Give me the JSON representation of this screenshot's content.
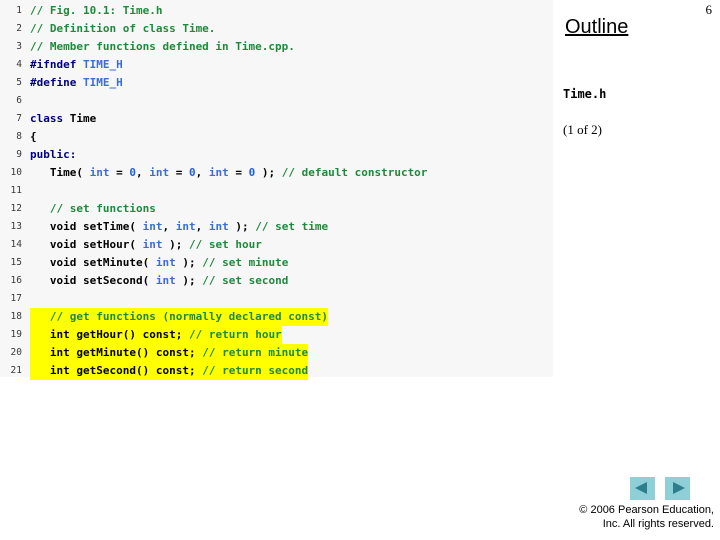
{
  "page_number": "6",
  "outline": {
    "title": "Outline",
    "file_label": "Time.h",
    "part_label": "(1 of 2)"
  },
  "footer": {
    "prev_label": "previous-slide",
    "next_label": "next-slide",
    "copyright_line1": "© 2006 Pearson Education,",
    "copyright_line2": "Inc.  All rights reserved."
  },
  "colors": {
    "panel_bg": "#f7f7f7",
    "keyword": "#000080",
    "type": "#3c6ed4",
    "number": "#1f5fd8",
    "comment": "#1f8a3c",
    "highlight": "#ffff00",
    "nav_button_bg": "#8ecfd8",
    "nav_arrow": "#2e7f8c"
  },
  "code": {
    "language": "cpp",
    "lines": [
      {
        "n": "1",
        "highlight": false,
        "tokens": [
          {
            "t": "// Fig. 10.1: Time.h",
            "c": "cmt"
          }
        ]
      },
      {
        "n": "2",
        "highlight": false,
        "tokens": [
          {
            "t": "// Definition of class Time.",
            "c": "cmt"
          }
        ]
      },
      {
        "n": "3",
        "highlight": false,
        "tokens": [
          {
            "t": "// Member functions defined in Time.cpp.",
            "c": "cmt"
          }
        ]
      },
      {
        "n": "4",
        "highlight": false,
        "tokens": [
          {
            "t": "#ifndef",
            "c": "pp"
          },
          {
            "t": " ",
            "c": "pl"
          },
          {
            "t": "TIME_H",
            "c": "ppid"
          }
        ]
      },
      {
        "n": "5",
        "highlight": false,
        "tokens": [
          {
            "t": "#define",
            "c": "pp"
          },
          {
            "t": " ",
            "c": "pl"
          },
          {
            "t": "TIME_H",
            "c": "ppid"
          }
        ]
      },
      {
        "n": "6",
        "highlight": false,
        "tokens": []
      },
      {
        "n": "7",
        "highlight": false,
        "tokens": [
          {
            "t": "class",
            "c": "kw"
          },
          {
            "t": " Time",
            "c": "pl"
          }
        ]
      },
      {
        "n": "8",
        "highlight": false,
        "tokens": [
          {
            "t": "{",
            "c": "pl"
          }
        ]
      },
      {
        "n": "9",
        "highlight": false,
        "tokens": [
          {
            "t": "public:",
            "c": "kw"
          }
        ]
      },
      {
        "n": "10",
        "highlight": false,
        "tokens": [
          {
            "t": "   Time( ",
            "c": "pl"
          },
          {
            "t": "int",
            "c": "type"
          },
          {
            "t": " = ",
            "c": "pl"
          },
          {
            "t": "0",
            "c": "num"
          },
          {
            "t": ", ",
            "c": "pl"
          },
          {
            "t": "int",
            "c": "type"
          },
          {
            "t": " = ",
            "c": "pl"
          },
          {
            "t": "0",
            "c": "num"
          },
          {
            "t": ", ",
            "c": "pl"
          },
          {
            "t": "int",
            "c": "type"
          },
          {
            "t": " = ",
            "c": "pl"
          },
          {
            "t": "0",
            "c": "num"
          },
          {
            "t": " ); ",
            "c": "pl"
          },
          {
            "t": "// default constructor",
            "c": "cmt"
          }
        ]
      },
      {
        "n": "11",
        "highlight": false,
        "tokens": []
      },
      {
        "n": "12",
        "highlight": false,
        "tokens": [
          {
            "t": "   ",
            "c": "pl"
          },
          {
            "t": "// set functions",
            "c": "cmt"
          }
        ]
      },
      {
        "n": "13",
        "highlight": false,
        "tokens": [
          {
            "t": "   void setTime( ",
            "c": "pl"
          },
          {
            "t": "int",
            "c": "type"
          },
          {
            "t": ", ",
            "c": "pl"
          },
          {
            "t": "int",
            "c": "type"
          },
          {
            "t": ", ",
            "c": "pl"
          },
          {
            "t": "int",
            "c": "type"
          },
          {
            "t": " ); ",
            "c": "pl"
          },
          {
            "t": "// set time",
            "c": "cmt"
          }
        ]
      },
      {
        "n": "14",
        "highlight": false,
        "tokens": [
          {
            "t": "   void setHour( ",
            "c": "pl"
          },
          {
            "t": "int",
            "c": "type"
          },
          {
            "t": " ); ",
            "c": "pl"
          },
          {
            "t": "// set hour",
            "c": "cmt"
          }
        ]
      },
      {
        "n": "15",
        "highlight": false,
        "tokens": [
          {
            "t": "   void setMinute( ",
            "c": "pl"
          },
          {
            "t": "int",
            "c": "type"
          },
          {
            "t": " ); ",
            "c": "pl"
          },
          {
            "t": "// set minute",
            "c": "cmt"
          }
        ]
      },
      {
        "n": "16",
        "highlight": false,
        "tokens": [
          {
            "t": "   void setSecond( ",
            "c": "pl"
          },
          {
            "t": "int",
            "c": "type"
          },
          {
            "t": " ); ",
            "c": "pl"
          },
          {
            "t": "// set second",
            "c": "cmt"
          }
        ]
      },
      {
        "n": "17",
        "highlight": false,
        "tokens": []
      },
      {
        "n": "18",
        "highlight": true,
        "tokens": [
          {
            "t": "   ",
            "c": "pl"
          },
          {
            "t": "// get functions (normally declared const)",
            "c": "cmt"
          }
        ]
      },
      {
        "n": "19",
        "highlight": true,
        "tokens": [
          {
            "t": "   ",
            "c": "pl"
          },
          {
            "t": "int",
            "c": "type"
          },
          {
            "t": " getHour() const; ",
            "c": "pl"
          },
          {
            "t": "// return hour",
            "c": "cmt"
          }
        ]
      },
      {
        "n": "20",
        "highlight": true,
        "tokens": [
          {
            "t": "   ",
            "c": "pl"
          },
          {
            "t": "int",
            "c": "type"
          },
          {
            "t": " getMinute() const; ",
            "c": "pl"
          },
          {
            "t": "// return minute",
            "c": "cmt"
          }
        ]
      },
      {
        "n": "21",
        "highlight": true,
        "tokens": [
          {
            "t": "   ",
            "c": "pl"
          },
          {
            "t": "int",
            "c": "type"
          },
          {
            "t": " getSecond() const; ",
            "c": "pl"
          },
          {
            "t": "// return second",
            "c": "cmt"
          }
        ]
      }
    ]
  }
}
